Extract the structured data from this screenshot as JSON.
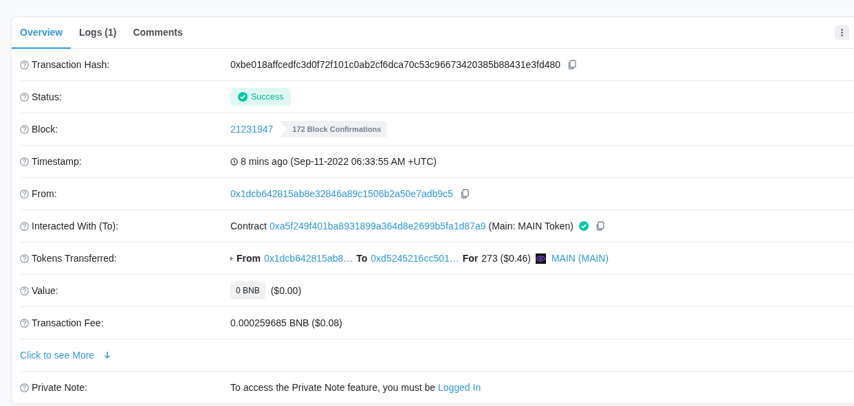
{
  "tabs": [
    {
      "label": "Overview",
      "selected": true
    },
    {
      "label": "Logs (1)",
      "selected": false
    },
    {
      "label": "Comments",
      "selected": false
    }
  ],
  "rows": [
    {
      "label": "Transaction Hash:",
      "help": true,
      "parts": [
        {
          "kind": "text",
          "text": "0xbe018affcedfc3d0f72f101c0ab2cf6dca70c53c96673420385b88431e3fd480"
        },
        {
          "kind": "copy"
        }
      ]
    },
    {
      "label": "Status:",
      "help": true,
      "parts": [
        {
          "kind": "status",
          "text": "Success"
        }
      ]
    },
    {
      "label": "Block:",
      "help": true,
      "parts": [
        {
          "kind": "link",
          "text": "21231947"
        },
        {
          "kind": "confirm",
          "text": "172 Block Confirmations"
        }
      ]
    },
    {
      "label": "Timestamp:",
      "help": true,
      "parts": [
        {
          "kind": "clock"
        },
        {
          "kind": "text",
          "text": "8 mins ago (Sep-11-2022 06:33:55 AM +UTC)"
        }
      ]
    },
    {
      "label": "From:",
      "help": true,
      "parts": [
        {
          "kind": "link",
          "text": "0x1dcb642815ab8e32846a89c1506b2a50e7adb9c5"
        },
        {
          "kind": "copy"
        }
      ]
    },
    {
      "label": "Interacted With (To):",
      "help": true,
      "parts": [
        {
          "kind": "text",
          "text": "Contract"
        },
        {
          "kind": "link",
          "text": "0xa5f249f401ba8931899a364d8e2699b5fa1d87a9"
        },
        {
          "kind": "text",
          "text": "(Main: MAIN Token)"
        },
        {
          "kind": "verified"
        },
        {
          "kind": "copy"
        }
      ]
    },
    {
      "label": "Tokens Transferred:",
      "help": true,
      "parts": [
        {
          "kind": "caret"
        },
        {
          "kind": "bold",
          "text": "From"
        },
        {
          "kind": "link",
          "text": "0x1dcb642815ab8…"
        },
        {
          "kind": "bold",
          "text": "To"
        },
        {
          "kind": "link",
          "text": "0xd5245216cc501…"
        },
        {
          "kind": "bold",
          "text": "For"
        },
        {
          "kind": "text",
          "text": "273 ($0.46)"
        },
        {
          "kind": "token-logo"
        },
        {
          "kind": "link",
          "text": "MAIN (MAIN)"
        }
      ]
    },
    {
      "label": "Value:",
      "help": true,
      "parts": [
        {
          "kind": "chip",
          "text": "0 BNB"
        },
        {
          "kind": "text",
          "text": "($0.00)"
        }
      ]
    },
    {
      "label": "Transaction Fee:",
      "help": true,
      "parts": [
        {
          "kind": "text",
          "text": "0.000259685 BNB ($0.08)"
        }
      ]
    },
    {
      "label": "Click to see More",
      "kind": "more",
      "parts": []
    },
    {
      "label": "Private Note:",
      "help": true,
      "parts": [
        {
          "kind": "note",
          "text": "To access the Private Note feature, you must be",
          "link": "Logged In"
        }
      ]
    }
  ]
}
